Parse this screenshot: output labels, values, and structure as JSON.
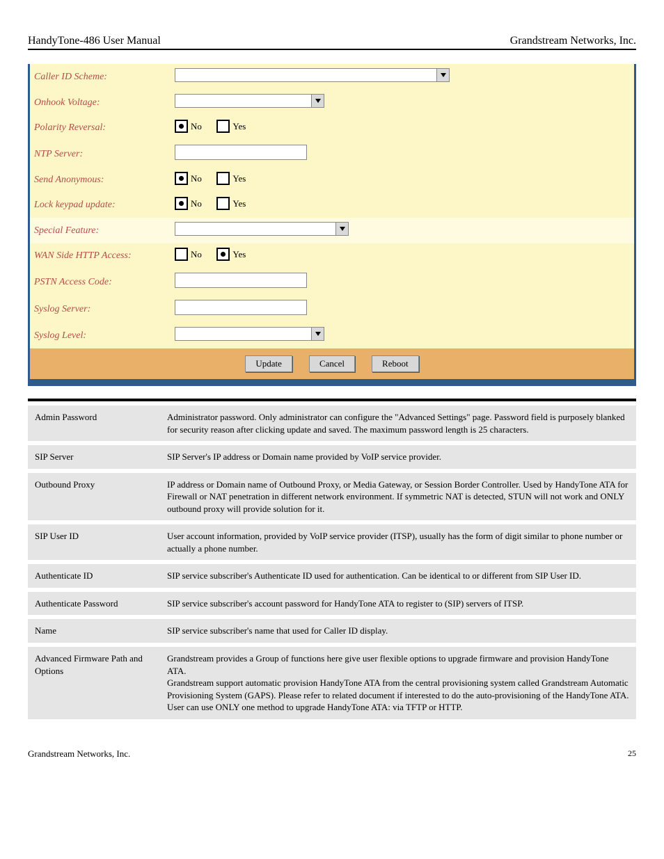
{
  "header": {
    "left": "HandyTone-486 User Manual",
    "right": "Grandstream Networks, Inc."
  },
  "form": {
    "rows": {
      "caller_id_scheme": {
        "label": "Caller ID Scheme:"
      },
      "onhook_voltage": {
        "label": "Onhook Voltage:"
      },
      "polarity_reversal": {
        "label": "Polarity Reversal:",
        "opt_no": "No",
        "opt_yes": "Yes",
        "selected": "no"
      },
      "ntp_server": {
        "label": "NTP Server:"
      },
      "send_anonymous": {
        "label": "Send Anonymous:",
        "opt_no": "No",
        "opt_yes": "Yes",
        "selected": "no"
      },
      "lock_keypad_update": {
        "label": "Lock keypad update:",
        "opt_no": "No",
        "opt_yes": "Yes",
        "selected": "no"
      },
      "special_feature": {
        "label": "Special Feature:"
      },
      "wan_side_http": {
        "label": "WAN Side HTTP Access:",
        "opt_no": "No",
        "opt_yes": "Yes",
        "selected": "yes"
      },
      "pstn_access_code": {
        "label": "PSTN Access Code:"
      },
      "syslog_server": {
        "label": "Syslog Server:"
      },
      "syslog_level": {
        "label": "Syslog Level:"
      }
    },
    "buttons": {
      "update": "Update",
      "cancel": "Cancel",
      "reboot": "Reboot"
    }
  },
  "desc": [
    {
      "k": "Admin Password",
      "v": "Administrator password. Only administrator can configure the \"Advanced Settings\" page. Password field is purposely blanked for security reason after clicking update and saved. The maximum password length is 25 characters."
    },
    {
      "k": "SIP Server",
      "v": "SIP Server's IP address or Domain name provided by VoIP service provider."
    },
    {
      "k": "Outbound Proxy",
      "v": "IP address or Domain name of Outbound Proxy, or Media Gateway, or Session Border Controller. Used by HandyTone ATA for Firewall or NAT penetration in different network environment. If symmetric NAT is detected, STUN will not work and ONLY outbound proxy will provide solution for it."
    },
    {
      "k": "SIP User ID",
      "v": "User account information, provided by VoIP service provider (ITSP), usually has the form of digit similar to phone number or actually a phone number."
    },
    {
      "k": "Authenticate ID",
      "v": "SIP service subscriber's Authenticate ID used for authentication. Can be identical to or different from SIP User ID."
    },
    {
      "k": "Authenticate Password",
      "v": "SIP service subscriber's account password for HandyTone ATA to register to (SIP) servers of ITSP."
    },
    {
      "k": "Name",
      "v": "SIP service subscriber's name that used for Caller ID display."
    },
    {
      "k": "Advanced Firmware Path and Options",
      "v": "Grandstream provides a Group of functions here give user flexible options to upgrade firmware and provision HandyTone ATA.\nGrandstream support automatic provision HandyTone ATA from the central provisioning system called Grandstream Automatic Provisioning System (GAPS). Please refer to related document if interested to do the auto-provisioning of the HandyTone ATA.\nUser can use ONLY one method to upgrade HandyTone ATA: via TFTP or HTTP."
    }
  ],
  "footer": {
    "brand": "Grandstream Networks, Inc.",
    "page_num": "25"
  }
}
